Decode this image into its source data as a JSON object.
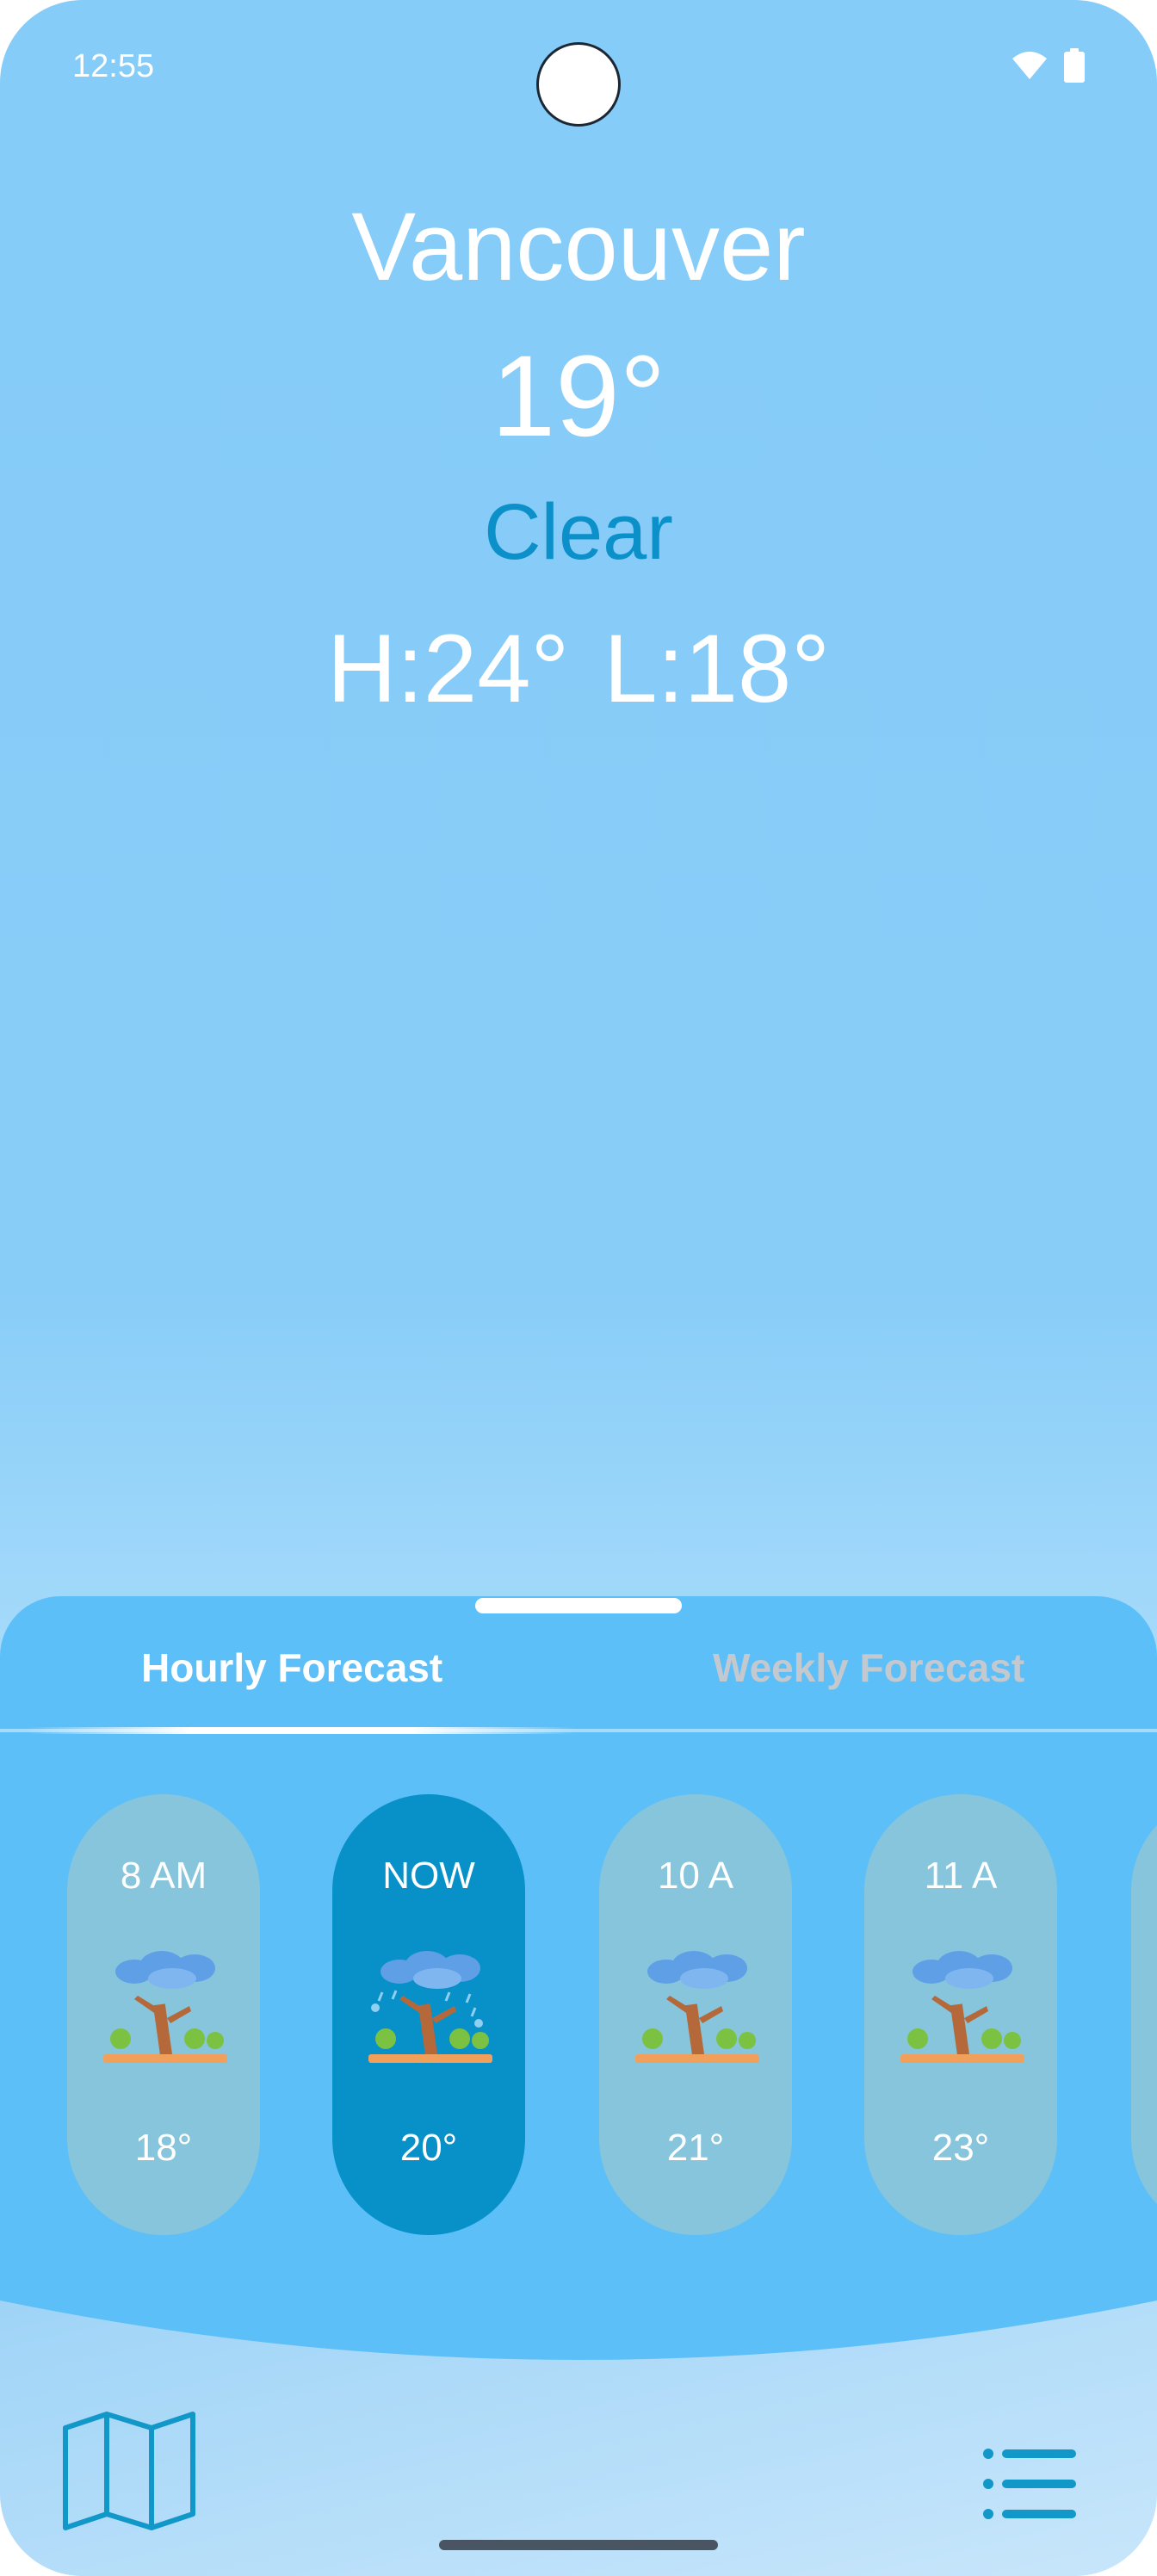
{
  "status_bar": {
    "time": "12:55",
    "icons": [
      "wifi-icon",
      "battery-icon"
    ]
  },
  "weather": {
    "city": "Vancouver",
    "temperature": "19°",
    "condition": "Clear",
    "high": "H:24°",
    "low": "L:18°"
  },
  "tabs": {
    "hourly": "Hourly Forecast",
    "weekly": "Weekly Forecast",
    "selected": "hourly"
  },
  "hourly": [
    {
      "time": "8 AM",
      "temp": "18°",
      "icon": "rain-cloud-tree-icon",
      "active": false
    },
    {
      "time": "NOW",
      "temp": "20°",
      "icon": "storm-cloud-tree-icon",
      "active": true
    },
    {
      "time": "10 A",
      "temp": "21°",
      "icon": "rain-cloud-tree-icon",
      "active": false
    },
    {
      "time": "11 A",
      "temp": "23°",
      "icon": "rain-cloud-tree-icon",
      "active": false
    }
  ],
  "bottom_nav": {
    "left_icon": "map-icon",
    "right_icon": "list-icon"
  },
  "colors": {
    "condition": "#0b90c9",
    "sheet": "#5cbff8",
    "card": "#86c5dc",
    "card_active": "#0891c8",
    "tab_inactive": "#c4c9d0"
  }
}
